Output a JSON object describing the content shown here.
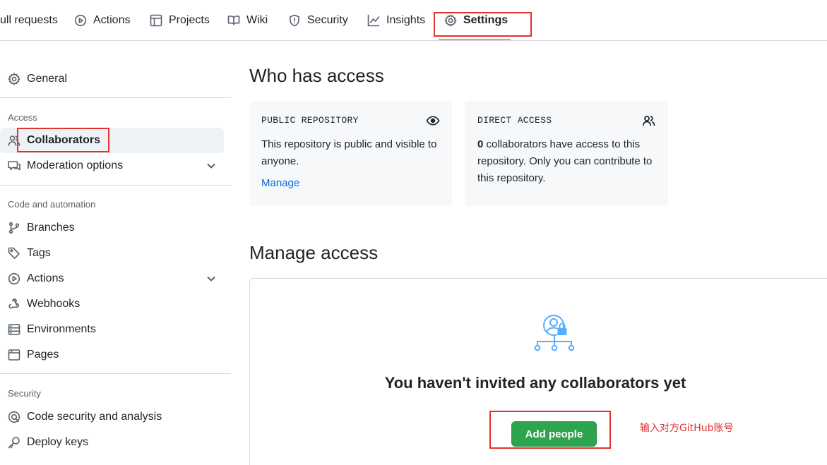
{
  "nav": {
    "tabs": [
      {
        "label": "ull requests",
        "icon": "pull-request-icon"
      },
      {
        "label": "Actions",
        "icon": "play-icon"
      },
      {
        "label": "Projects",
        "icon": "table-icon"
      },
      {
        "label": "Wiki",
        "icon": "book-icon"
      },
      {
        "label": "Security",
        "icon": "shield-icon"
      },
      {
        "label": "Insights",
        "icon": "graph-icon"
      },
      {
        "label": "Settings",
        "icon": "gear-icon",
        "selected": true
      }
    ],
    "underline_color": "#fd8c73"
  },
  "sidebar": {
    "general": "General",
    "sections": [
      {
        "heading": "Access",
        "items": [
          "Collaborators",
          "Moderation options"
        ]
      },
      {
        "heading": "Code and automation",
        "items": [
          "Branches",
          "Tags",
          "Actions",
          "Webhooks",
          "Environments",
          "Pages"
        ]
      },
      {
        "heading": "Security",
        "items": [
          "Code security and analysis",
          "Deploy keys"
        ]
      }
    ],
    "active": "Collaborators"
  },
  "main": {
    "who_title": "Who has access",
    "public_card": {
      "label": "PUBLIC REPOSITORY",
      "text": "This repository is public and visible to anyone.",
      "link": "Manage"
    },
    "direct_card": {
      "label": "DIRECT ACCESS",
      "count": "0",
      "text": " collaborators have access to this repository. Only you can contribute to this repository."
    },
    "manage_title": "Manage access",
    "blank_title": "You haven't invited any collaborators yet",
    "add_button": "Add people",
    "annotation": "输入对方GitHub账号"
  },
  "colors": {
    "accent_green": "#2da44e",
    "link_blue": "#0969da",
    "highlight_red": "#e5312f"
  }
}
